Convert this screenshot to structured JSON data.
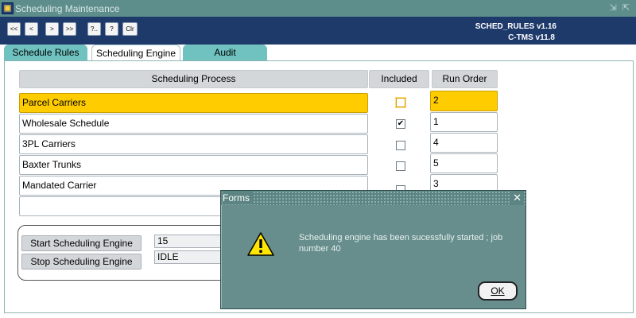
{
  "window": {
    "title": "Scheduling Maintenance",
    "icon": "oracle-forms-app-icon",
    "controls": "⇲ ⇱"
  },
  "toolbar": {
    "buttons": [
      "<<",
      "<",
      ">",
      ">>",
      "?..",
      "?",
      "Clr"
    ],
    "version_primary": "SCHED_RULES v1.16",
    "version_secondary": "C-TMS v11.8"
  },
  "tabs": [
    {
      "label": "Schedule Rules",
      "active": false
    },
    {
      "label": "Scheduling Engine",
      "active": true
    },
    {
      "label": "Audit",
      "active": false
    }
  ],
  "table": {
    "headers": {
      "process": "Scheduling Process",
      "included": "Included",
      "run_order": "Run Order"
    },
    "rows": [
      {
        "process": "Parcel Carriers",
        "included": false,
        "included_mark": "",
        "run_order": "2",
        "selected": true
      },
      {
        "process": "Wholesale Schedule",
        "included": true,
        "included_mark": "✔",
        "run_order": "1",
        "selected": false
      },
      {
        "process": "3PL Carriers",
        "included": false,
        "included_mark": "",
        "run_order": "4",
        "selected": false
      },
      {
        "process": "Baxter Trunks",
        "included": false,
        "included_mark": "",
        "run_order": "5",
        "selected": false
      },
      {
        "process": "Mandated Carrier",
        "included": false,
        "included_mark": "",
        "run_order": "3",
        "selected": false
      },
      {
        "process": "",
        "included": false,
        "included_mark": "",
        "run_order": "",
        "selected": false
      }
    ]
  },
  "engine": {
    "start_label": "Start Scheduling Engine",
    "stop_label": "Stop Scheduling Engine",
    "job_value": "15",
    "status_value": "IDLE"
  },
  "dialog": {
    "title": "Forms",
    "close_glyph": "✕",
    "message": "Scheduling engine has been sucessfully started ; job number 40",
    "icon": "warning-icon",
    "ok_label": "OK"
  },
  "colors": {
    "selected_row": "#ffcc00",
    "header_bar": "#1d3a6b",
    "tab_inactive": "#6fc2c0",
    "dialog_bg": "#678e8c"
  }
}
